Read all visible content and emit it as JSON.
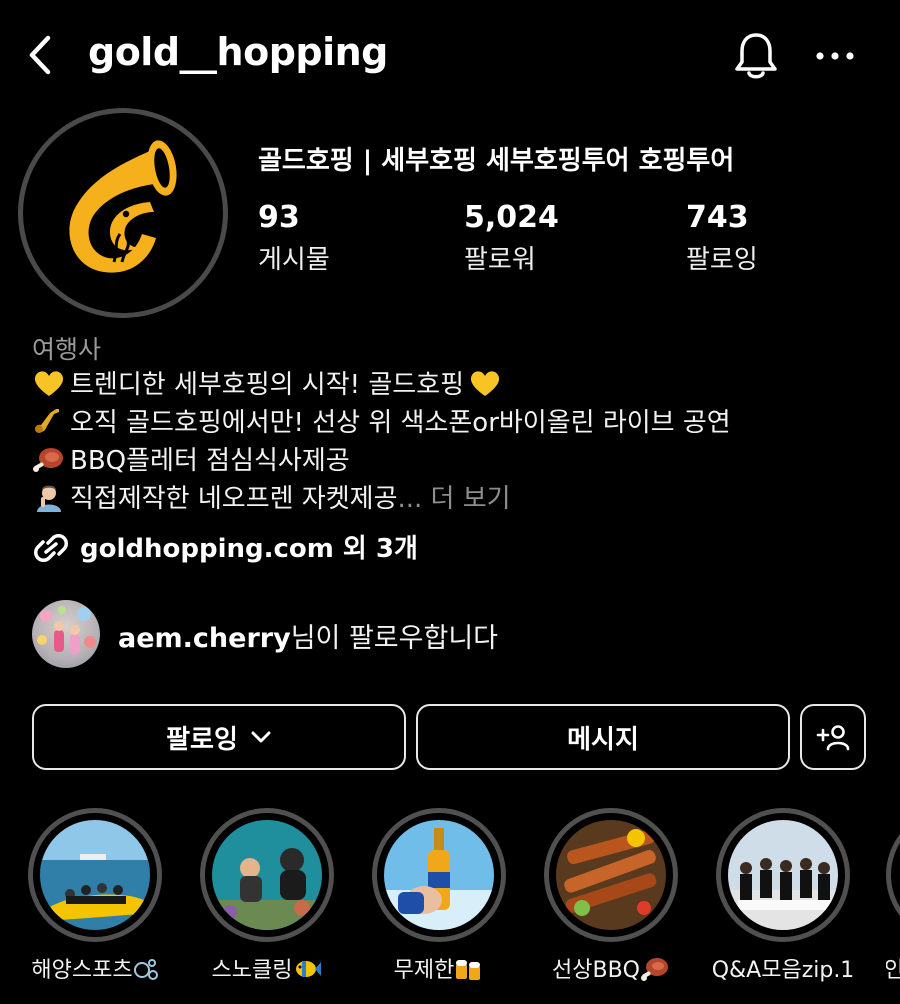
{
  "header": {
    "username": "gold__hopping",
    "back_icon": "chevron-left-icon",
    "bell_icon": "bell-icon",
    "more_icon": "more-horizontal-icon"
  },
  "profile": {
    "full_name": "골드호핑 | 세부호핑 세부호핑투어 호핑투어",
    "stats": [
      {
        "value": "93",
        "label": "게시물"
      },
      {
        "value": "5,024",
        "label": "팔로워"
      },
      {
        "value": "743",
        "label": "팔로잉"
      }
    ],
    "category": "여행사",
    "bio": [
      {
        "icon": "yellow-heart-icon",
        "text": "트렌디한 세부호핑의 시작! 골드호핑",
        "trailing_icon": "yellow-heart-icon"
      },
      {
        "icon": "saxophone-icon",
        "text": "오직 골드호핑에서만! 선상 위 색소폰or바이올린 라이브 공연"
      },
      {
        "icon": "meat-on-bone-icon",
        "text": "BBQ플레터 점심식사제공"
      },
      {
        "icon": "person-gesturing-icon",
        "text": "직접제작한 네오프렌 자켓제공"
      }
    ],
    "bio_more": "... 더 보기",
    "link": "goldhopping.com",
    "link_more": " 외 3개"
  },
  "followed_by": {
    "username": "aem.cherry",
    "suffix": "님이 팔로우합니다"
  },
  "actions": {
    "follow_label": "팔로잉",
    "message_label": "메시지",
    "add_user_icon": "add-person-icon"
  },
  "highlights": [
    {
      "label": "해양스포츠",
      "icon": "bubbles-icon"
    },
    {
      "label": "스노클링",
      "icon": "tropical-fish-icon"
    },
    {
      "label": "무제한",
      "icon": "beer-mugs-icon"
    },
    {
      "label": "선상BBQ",
      "icon": "meat-on-bone-icon"
    },
    {
      "label": "Q&A모음zip.1",
      "icon": ""
    },
    {
      "label": "인",
      "icon": ""
    }
  ],
  "colors": {
    "background": "#000000",
    "brand_gold": "#F5B01C",
    "secondary_text": "#8E8E8E"
  }
}
